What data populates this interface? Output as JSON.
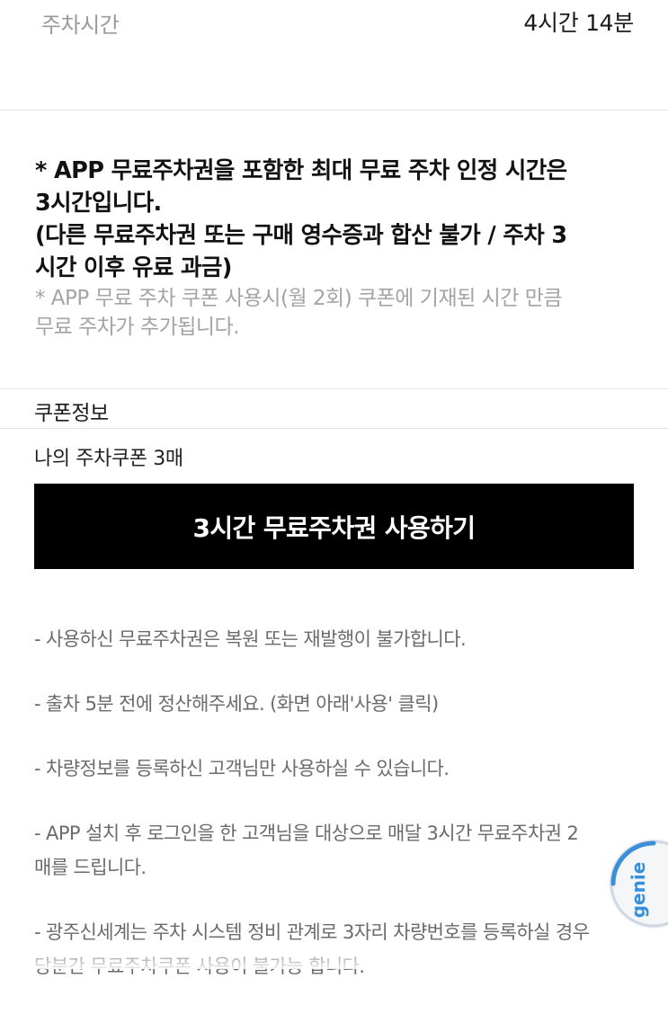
{
  "parking_time": {
    "label": "주차시간",
    "value": "4시간 14분"
  },
  "notice": {
    "bold_lines": "* APP 무료주차권을 포함한 최대 무료 주차 인정 시간은\n3시간입니다.\n(다른 무료주차권 또는 구매 영수증과 합산 불가 / 주차 3\n시간 이후 유료 과금)",
    "sub_lines": "* APP 무료 주차 쿠폰 사용시(월 2회) 쿠폰에 기재된 시간 만큼\n무료 주차가 추가됩니다."
  },
  "coupon": {
    "section_title": "쿠폰정보",
    "my_coupons": "나의 주차쿠폰 3매",
    "use_button_label": "3시간 무료주차권 사용하기"
  },
  "info_items": [
    "- 사용하신 무료주차권은 복원 또는 재발행이 불가합니다.",
    "- 출차 5분 전에 정산해주세요. (화면 아래'사용' 클릭)",
    "- 차량정보를 등록하신 고객님만 사용하실 수 있습니다.",
    "- APP 설치 후 로그인을 한 고객님을 대상으로 매달 3시간 무료주차권 2\n매를 드립니다.",
    "- 광주신세계는 주차 시스템 정비 관계로 3자리 차량번호를 등록하실 경우\n당분간 무료주차쿠폰 사용이 불가능 합니다."
  ],
  "watermark": {
    "text": "genie",
    "color": "#3b8fd9"
  }
}
